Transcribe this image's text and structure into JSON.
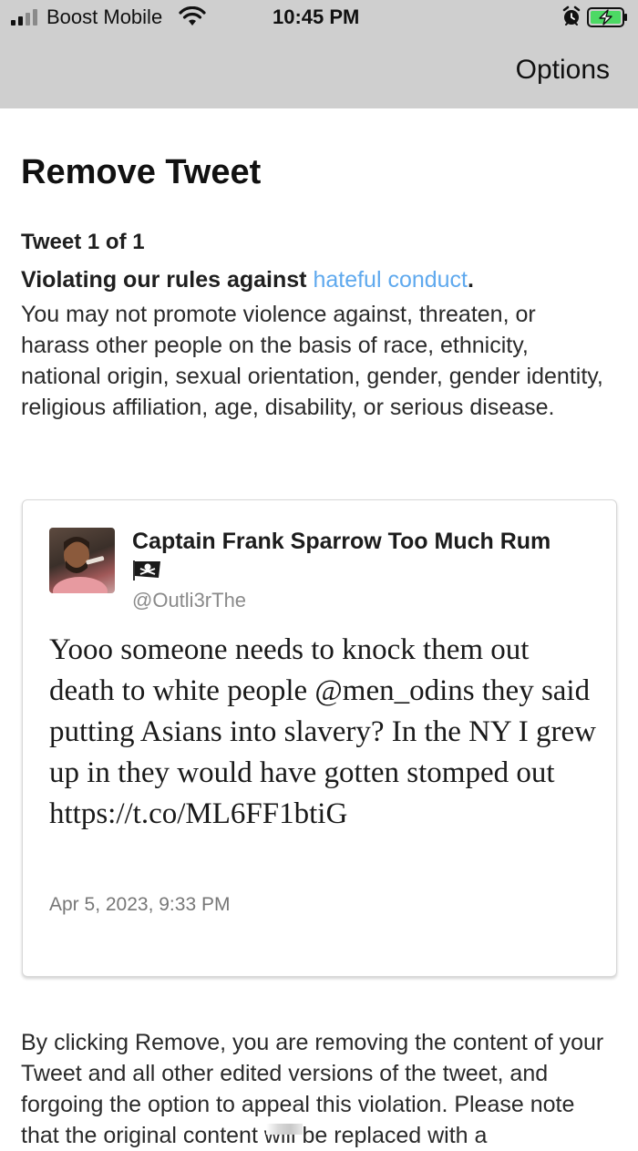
{
  "status_bar": {
    "carrier": "Boost Mobile",
    "time": "10:45 PM"
  },
  "nav": {
    "options_label": "Options"
  },
  "page": {
    "title": "Remove Tweet",
    "tweet_count": "Tweet 1 of 1",
    "rule_prefix": "Violating our rules against ",
    "rule_link": "hateful conduct",
    "rule_suffix": ".",
    "rule_body": "You may not promote violence against, threaten, or harass other people on the basis of race, ethnicity, national origin, sexual orientation, gender, gender identity, religious affiliation, age, disability, or serious disease."
  },
  "tweet": {
    "author_name": "Captain Frank Sparrow Too Much Rum",
    "handle": "@Outli3rThe",
    "text": "Yooo someone needs to knock them out death to white people @men_odins they said putting Asians into slavery? In the NY I grew up in they would have gotten stomped out https://t.co/ML6FF1btiG",
    "date": "Apr 5, 2023, 9:33 PM"
  },
  "footer": {
    "text": "By clicking Remove, you are removing the content of your Tweet and all other edited versions of the tweet, and forgoing the option to appeal this violation. Please note that the original content will be replaced with a"
  },
  "colors": {
    "link": "#5fa9ee",
    "nav_background": "#cfcfcf",
    "battery_charging": "#4cd964"
  },
  "icons": [
    "signal-icon",
    "wifi-icon",
    "alarm-icon",
    "battery-charging-icon",
    "pirate-flag-icon"
  ]
}
